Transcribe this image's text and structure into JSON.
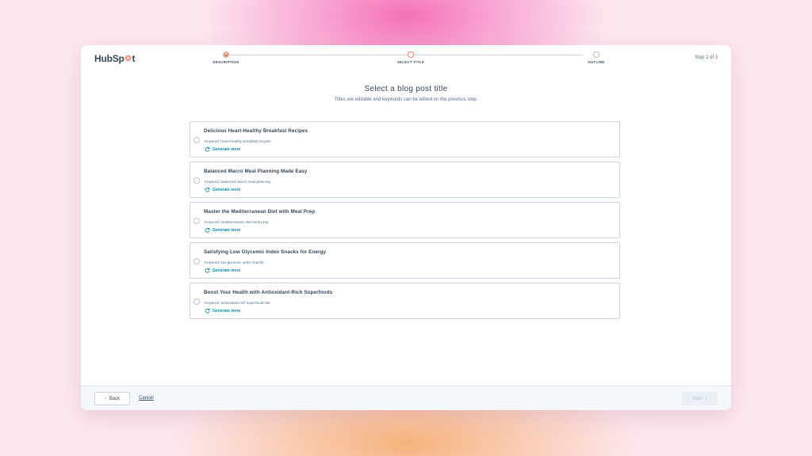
{
  "brand": {
    "logo_text_before": "HubSp",
    "logo_text_after": "t"
  },
  "stepper": {
    "steps": [
      {
        "label": "DESCRIPTION",
        "state": "done"
      },
      {
        "label": "SELECT TITLE",
        "state": "active"
      },
      {
        "label": "OUTLINE",
        "state": "pending"
      }
    ],
    "step_count": "Step 2 of 3"
  },
  "main": {
    "title": "Select a blog post title",
    "subtitle": "Titles are editable and keywords can be edited on the previous step."
  },
  "options": [
    {
      "title": "Delicious Heart-Healthy Breakfast Recipes",
      "keyword": "Keyword: heart-healthy breakfast recipes",
      "generate": "Generate more"
    },
    {
      "title": "Balanced Macro Meal Planning Made Easy",
      "keyword": "Keyword: balanced macro meal planning",
      "generate": "Generate more"
    },
    {
      "title": "Master the Mediterranean Diet with Meal Prep",
      "keyword": "Keyword: mediterranean diet meal prep",
      "generate": "Generate more"
    },
    {
      "title": "Satisfying Low Glycemic Index Snacks for Energy",
      "keyword": "Keyword: low glycemic index snacks",
      "generate": "Generate more"
    },
    {
      "title": "Boost Your Health with Antioxidant-Rich Superfoods",
      "keyword": "Keyword: antioxidant-rich superfoods list",
      "generate": "Generate more"
    }
  ],
  "footer": {
    "back_label": "Back",
    "cancel_label": "Cancel",
    "next_label": "Next"
  },
  "colors": {
    "accent": "#ff7a59",
    "link": "#0091ae",
    "text": "#33475b"
  }
}
